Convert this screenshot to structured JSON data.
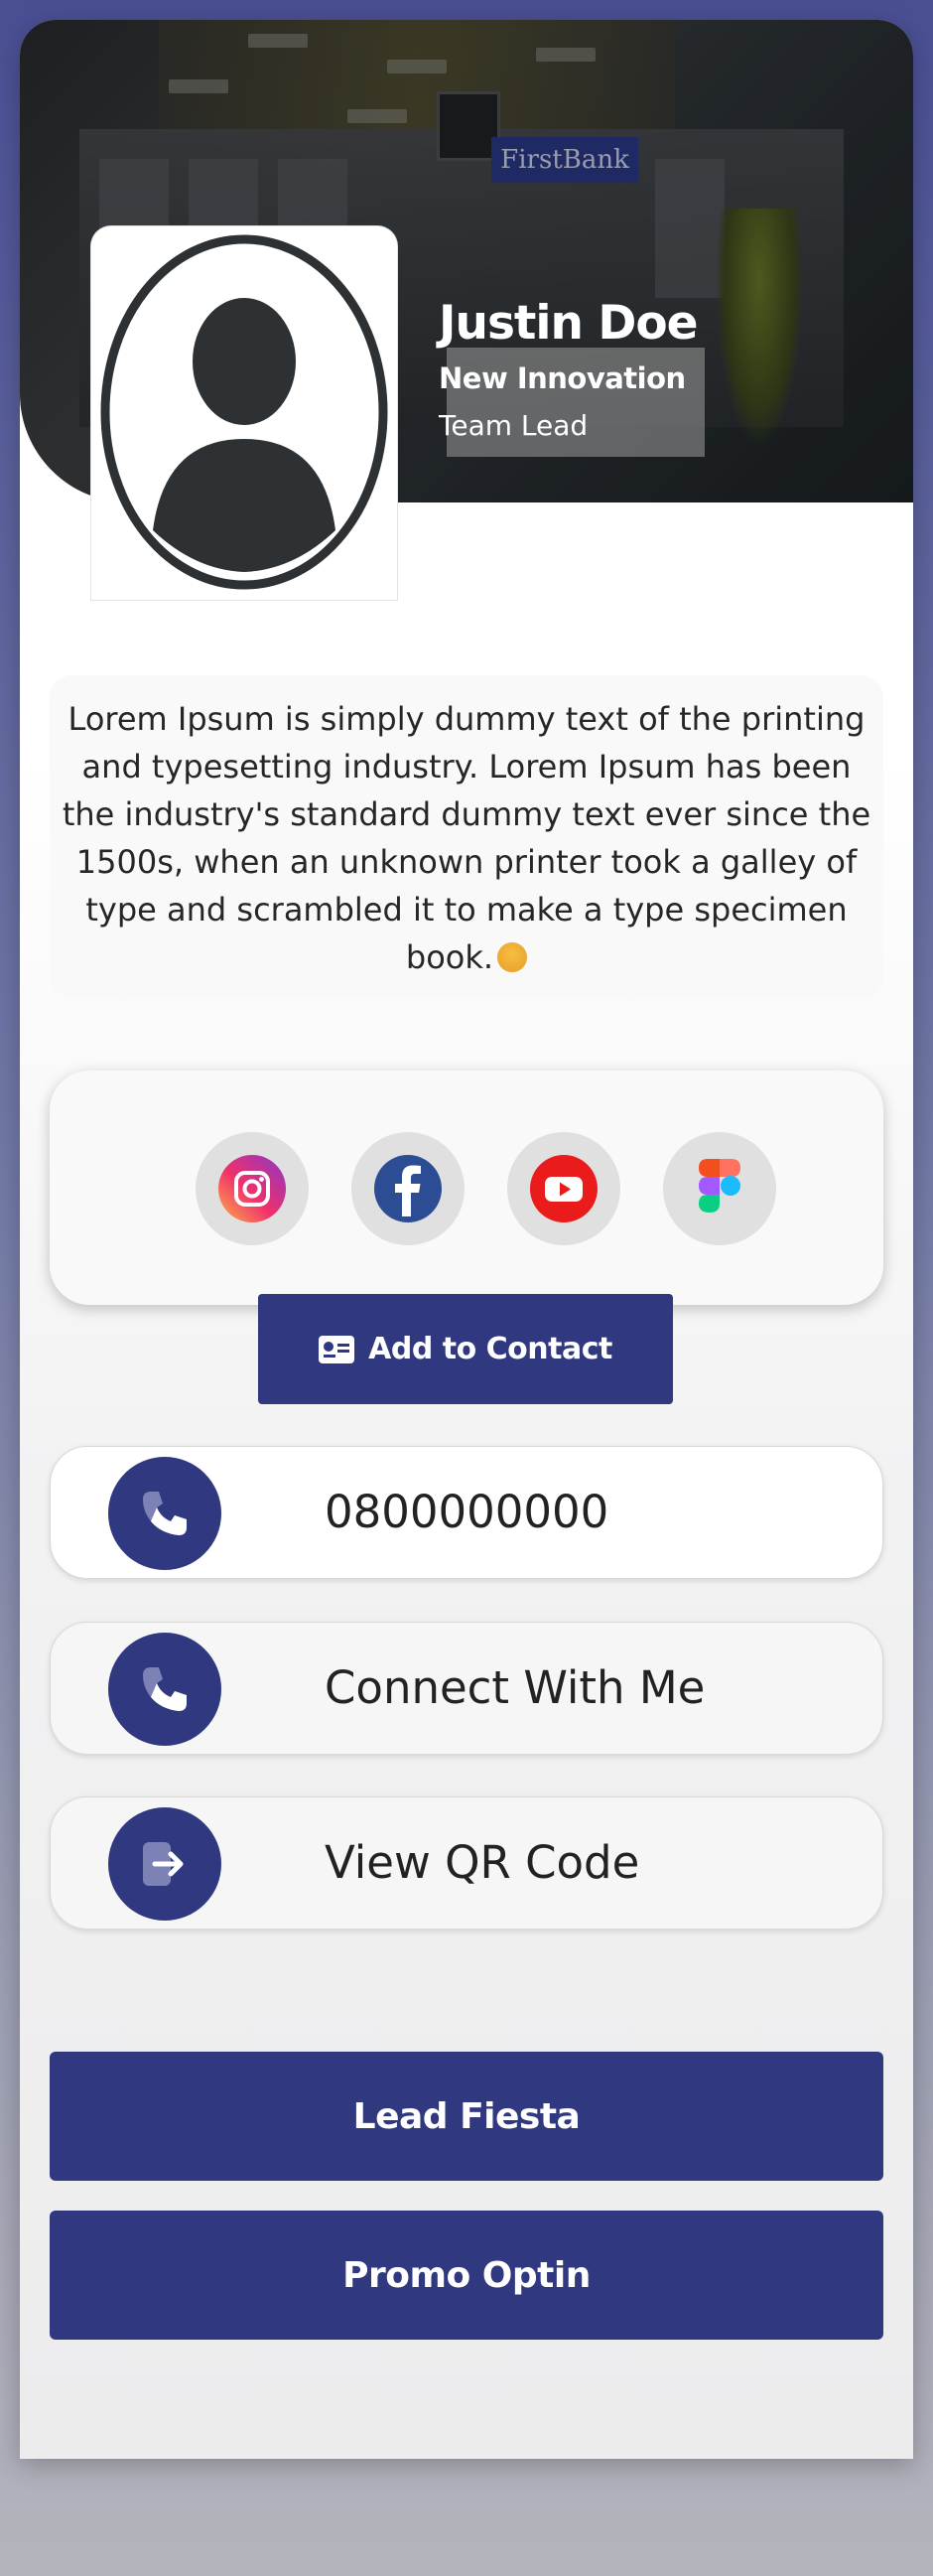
{
  "profile": {
    "name": "Justin Doe",
    "company": "New Innovation",
    "role": "Team Lead",
    "banner_sign": "FirstBank"
  },
  "bio": {
    "text": "Lorem Ipsum is simply dummy text of the printing and typesetting industry. Lorem Ipsum has been the industry's standard dummy text ever since the 1500s, when an unknown printer took a galley of type and scrambled it to make a type specimen book."
  },
  "social": {
    "items": [
      {
        "icon": "instagram-icon"
      },
      {
        "icon": "facebook-icon"
      },
      {
        "icon": "youtube-icon"
      },
      {
        "icon": "figma-icon"
      }
    ]
  },
  "actions": {
    "add_contact_label": "Add to Contact",
    "phone": "0800000000",
    "connect_label": "Connect With Me",
    "qr_label": "View QR Code"
  },
  "buttons": {
    "lead_fiesta": "Lead Fiesta",
    "promo_optin": "Promo Optin"
  },
  "colors": {
    "brand": "#303880",
    "background_top": "#4a4f94",
    "background_bottom": "#b4b4bc"
  }
}
